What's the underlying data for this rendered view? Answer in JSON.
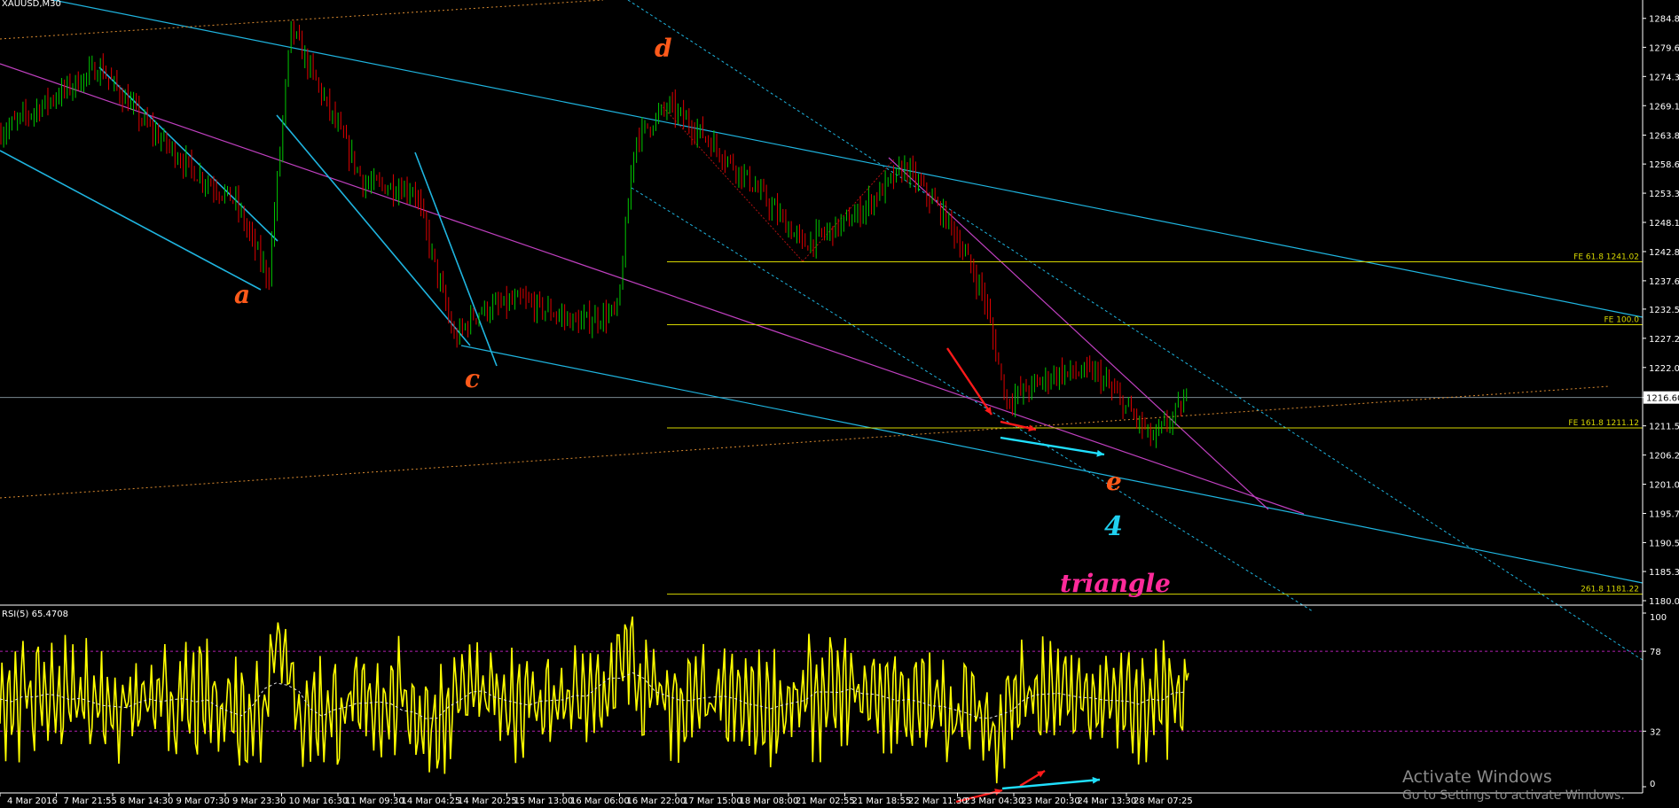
{
  "window": {
    "title": "XAUUSD,M30"
  },
  "indicator": {
    "title": "RSI(5) 65.4708"
  },
  "watermark": {
    "line1": "Activate Windows",
    "line2": "Go to Settings to activate Windows."
  },
  "colors": {
    "background": "#000000",
    "axis": "#ffffff",
    "bull_candle": "#00c800",
    "bear_candle": "#e00000",
    "channel_line": "#1fb5e0",
    "triangle_line": "#c040c0",
    "fib_line": "#d6d600",
    "dotted_orange": "#d98a30",
    "rsi_line": "#ffff00",
    "rsi_level": "#b01fb0",
    "wave_label": "#ff5a1a",
    "wave4_label": "#20d0f0",
    "triangle_label": "#ff2a9a",
    "arrow_red": "#ff1a1a",
    "arrow_cyan": "#20e0ff"
  },
  "chart_data": [
    {
      "type": "candlestick",
      "symbol": "XAUUSD",
      "timeframe": "M30",
      "title": "XAUUSD,M30",
      "ylim": [
        1180.05,
        1287.15
      ],
      "y_ticks": [
        "1284.80",
        "1279.60",
        "1274.35",
        "1269.10",
        "1263.80",
        "1258.60",
        "1253.35",
        "1248.10",
        "1242.85",
        "1237.60",
        "1232.50",
        "1227.25",
        "1222.00",
        "1216.60",
        "1211.50",
        "1206.25",
        "1201.00",
        "1195.75",
        "1190.50",
        "1185.30",
        "1180.05"
      ],
      "current_price": "1216.60",
      "x_ticks": [
        "4 Mar 2016",
        "7 Mar 21:55",
        "8 Mar 14:30",
        "9 Mar 07:30",
        "9 Mar 23:30",
        "10 Mar 16:30",
        "11 Mar 09:30",
        "14 Mar 04:25",
        "14 Mar 20:25",
        "15 Mar 13:00",
        "16 Mar 06:00",
        "16 Mar 22:00",
        "17 Mar 15:00",
        "18 Mar 08:00",
        "21 Mar 02:55",
        "21 Mar 18:55",
        "22 Mar 11:30",
        "23 Mar 04:30",
        "23 Mar 20:30",
        "24 Mar 13:30",
        "28 Mar 07:25"
      ],
      "price_path": [
        {
          "t": 0,
          "p": 1264
        },
        {
          "t": 0.9,
          "p": 1270
        },
        {
          "t": 1.8,
          "p": 1276
        },
        {
          "t": 2.6,
          "p": 1266
        },
        {
          "t": 3.5,
          "p": 1257
        },
        {
          "t": 4.2,
          "p": 1252
        },
        {
          "t": 4.8,
          "p": 1238
        },
        {
          "t": 5.2,
          "p": 1283
        },
        {
          "t": 5.8,
          "p": 1270
        },
        {
          "t": 6.5,
          "p": 1255
        },
        {
          "t": 7.4,
          "p": 1254
        },
        {
          "t": 8.1,
          "p": 1227
        },
        {
          "t": 8.5,
          "p": 1232
        },
        {
          "t": 9.3,
          "p": 1234
        },
        {
          "t": 10.3,
          "p": 1230
        },
        {
          "t": 11.0,
          "p": 1232
        },
        {
          "t": 11.3,
          "p": 1263
        },
        {
          "t": 11.9,
          "p": 1269
        },
        {
          "t": 12.5,
          "p": 1264
        },
        {
          "t": 13.3,
          "p": 1256
        },
        {
          "t": 14.3,
          "p": 1244
        },
        {
          "t": 15.2,
          "p": 1249
        },
        {
          "t": 16.1,
          "p": 1258
        },
        {
          "t": 16.9,
          "p": 1248
        },
        {
          "t": 17.5,
          "p": 1235
        },
        {
          "t": 17.9,
          "p": 1216
        },
        {
          "t": 18.8,
          "p": 1221
        },
        {
          "t": 19.5,
          "p": 1221
        },
        {
          "t": 20.1,
          "p": 1214
        },
        {
          "t": 20.5,
          "p": 1209
        },
        {
          "t": 21.1,
          "p": 1216
        }
      ],
      "fib_levels": [
        {
          "label": "FE 61.8 1241.02",
          "value": 1241.02
        },
        {
          "label": "FE 100.0",
          "value": 1229.7
        },
        {
          "label": "FE 161.8 1211.12",
          "value": 1211.12
        },
        {
          "label": "261.8 1181.22",
          "value": 1181.22
        }
      ],
      "wave_labels": {
        "a": "a",
        "c": "c",
        "d": "d",
        "e": "e",
        "wave4": "4",
        "pattern": "triangle"
      }
    },
    {
      "type": "line",
      "title": "RSI(5) 65.4708",
      "series_name": "RSI(5)",
      "value": 65.4708,
      "ylim": [
        0,
        100
      ],
      "y_ticks": [
        "100",
        "78",
        "32",
        "0"
      ],
      "levels": [
        78,
        32
      ]
    }
  ]
}
